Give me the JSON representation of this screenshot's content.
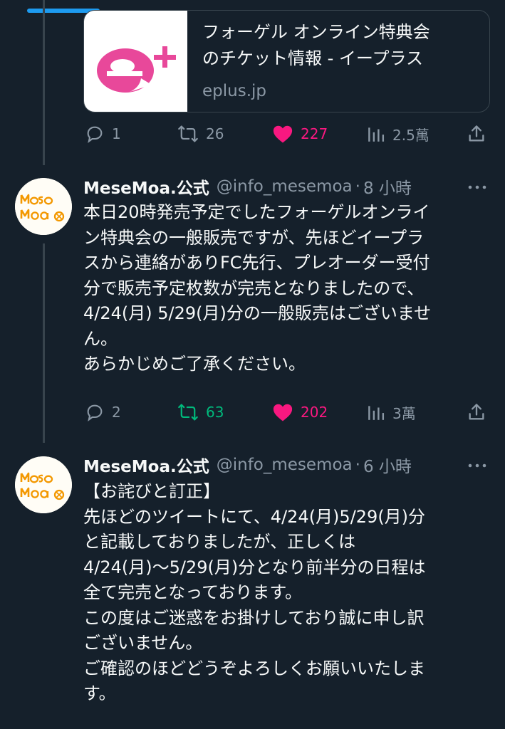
{
  "colors": {
    "background": "#15202b",
    "text": "#f7f9f9",
    "muted": "#8b98a5",
    "like": "#f91880",
    "retweet": "#00ba7c",
    "accent": "#1d9bf0",
    "brand_pink": "#e8489a",
    "brand_orange": "#f39800"
  },
  "link_card": {
    "logo_icon": "eplus-logo-icon",
    "title": "フォーゲル オンライン特典会\nのチケット情報 - イープラス",
    "domain": "eplus.jp"
  },
  "card_actions": {
    "replies": "1",
    "retweets": "26",
    "likes": "227",
    "views": "2.5萬"
  },
  "tweets": [
    {
      "avatar_icon": "mesemoa-logo-icon",
      "name": "MeseMoa.公式",
      "handle": "@info_mesemoa",
      "separator": "·",
      "time": "8 小時",
      "text": "本日20時発売予定でしたフォーゲルオンライ\nン特典会の一般販売ですが、先ほどイープラ\nスから連絡がありFC先行、プレオーダー受付\n分で販売予定枚数が完売となりましたので、\n4/24(月) 5/29(月)分の一般販売はございませ\nん。\nあらかじめご了承ください。",
      "replies": "2",
      "retweets": "63",
      "likes": "202",
      "views": "3萬"
    },
    {
      "avatar_icon": "mesemoa-logo-icon",
      "name": "MeseMoa.公式",
      "handle": "@info_mesemoa",
      "separator": "·",
      "time": "6 小時",
      "text": "【お詫びと訂正】\n先ほどのツイートにて、4/24(月)5/29(月)分\nと記載しておりましたが、正しくは\n4/24(月)～5/29(月)分となり前半分の日程は\n全て完売となっております。\nこの度はご迷惑をお掛けしており誠に申し訳\nございません。\nご確認のほどどうぞよろしくお願いいたしま\nす。"
    }
  ]
}
